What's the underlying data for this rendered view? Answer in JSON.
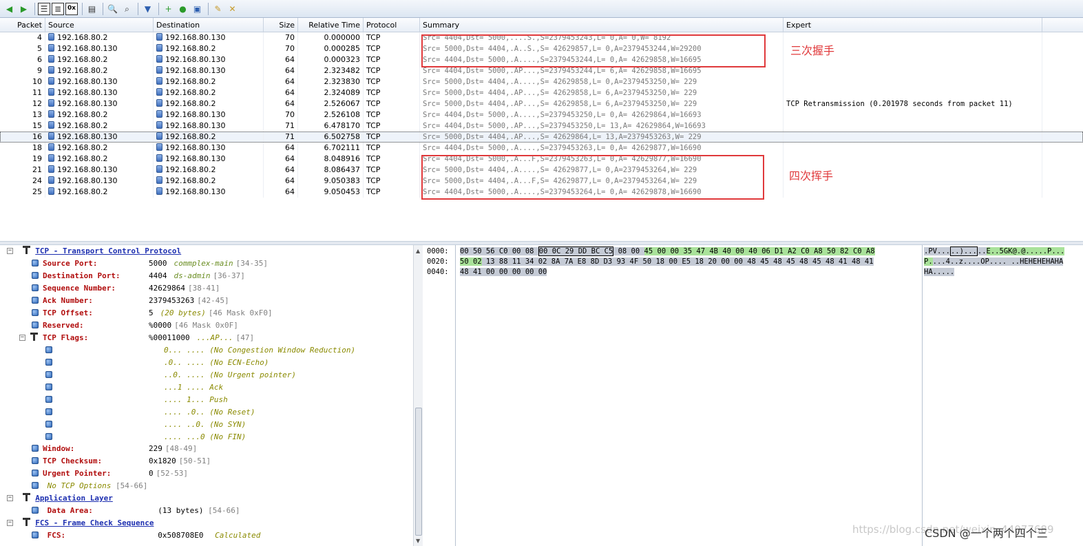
{
  "toolbar": {
    "buttons": [
      "back-icon",
      "forward-icon",
      "list-view-icon",
      "details-view-icon",
      "hex-view-icon",
      "packet-view-icon",
      "search-icon",
      "find-next-icon",
      "filter-icon",
      "add-icon",
      "capture-icon",
      "save-icon",
      "edit-icon",
      "clear-icon"
    ],
    "hex_button_label": "0x"
  },
  "grid": {
    "columns": [
      "Packet",
      "Source",
      "Destination",
      "Size",
      "Relative Time",
      "Protocol",
      "Summary",
      "Expert"
    ],
    "rows": [
      {
        "packet": "4",
        "source": "192.168.80.2",
        "dest": "192.168.80.130",
        "size": "70",
        "time": "0.000000",
        "protocol": "TCP",
        "summary": "Src= 4404,Dst= 5000,....S.,S=2379453243,L=    0,A=         0,W= 8192",
        "expert": ""
      },
      {
        "packet": "5",
        "source": "192.168.80.130",
        "dest": "192.168.80.2",
        "size": "70",
        "time": "0.000285",
        "protocol": "TCP",
        "summary": "Src= 5000,Dst= 4404,.A..S.,S=  42629857,L=    0,A=2379453244,W=29200",
        "expert": ""
      },
      {
        "packet": "6",
        "source": "192.168.80.2",
        "dest": "192.168.80.130",
        "size": "64",
        "time": "0.000323",
        "protocol": "TCP",
        "summary": "Src= 4404,Dst= 5000,.A....,S=2379453244,L=    0,A=  42629858,W=16695",
        "expert": ""
      },
      {
        "packet": "9",
        "source": "192.168.80.2",
        "dest": "192.168.80.130",
        "size": "64",
        "time": "2.323482",
        "protocol": "TCP",
        "summary": "Src= 4404,Dst= 5000,.AP...,S=2379453244,L=    6,A=  42629858,W=16695",
        "expert": ""
      },
      {
        "packet": "10",
        "source": "192.168.80.130",
        "dest": "192.168.80.2",
        "size": "64",
        "time": "2.323830",
        "protocol": "TCP",
        "summary": "Src= 5000,Dst= 4404,.A....,S=  42629858,L=    0,A=2379453250,W=  229",
        "expert": ""
      },
      {
        "packet": "11",
        "source": "192.168.80.130",
        "dest": "192.168.80.2",
        "size": "64",
        "time": "2.324089",
        "protocol": "TCP",
        "summary": "Src= 5000,Dst= 4404,.AP...,S=  42629858,L=    6,A=2379453250,W=  229",
        "expert": ""
      },
      {
        "packet": "12",
        "source": "192.168.80.130",
        "dest": "192.168.80.2",
        "size": "64",
        "time": "2.526067",
        "protocol": "TCP",
        "summary": "Src= 5000,Dst= 4404,.AP...,S=  42629858,L=    6,A=2379453250,W=  229",
        "expert": "TCP Retransmission (0.201978 seconds from packet 11)"
      },
      {
        "packet": "13",
        "source": "192.168.80.2",
        "dest": "192.168.80.130",
        "size": "70",
        "time": "2.526108",
        "protocol": "TCP",
        "summary": "Src= 4404,Dst= 5000,.A....,S=2379453250,L=    0,A=  42629864,W=16693",
        "expert": ""
      },
      {
        "packet": "15",
        "source": "192.168.80.2",
        "dest": "192.168.80.130",
        "size": "71",
        "time": "6.478170",
        "protocol": "TCP",
        "summary": "Src= 4404,Dst= 5000,.AP...,S=2379453250,L=   13,A=  42629864,W=16693",
        "expert": ""
      },
      {
        "packet": "16",
        "source": "192.168.80.130",
        "dest": "192.168.80.2",
        "size": "71",
        "time": "6.502758",
        "protocol": "TCP",
        "summary": "Src= 5000,Dst= 4404,.AP...,S=  42629864,L=   13,A=2379453263,W=  229",
        "expert": ""
      },
      {
        "packet": "18",
        "source": "192.168.80.2",
        "dest": "192.168.80.130",
        "size": "64",
        "time": "6.702111",
        "protocol": "TCP",
        "summary": "Src= 4404,Dst= 5000,.A....,S=2379453263,L=    0,A=  42629877,W=16690",
        "expert": ""
      },
      {
        "packet": "19",
        "source": "192.168.80.2",
        "dest": "192.168.80.130",
        "size": "64",
        "time": "8.048916",
        "protocol": "TCP",
        "summary": "Src= 4404,Dst= 5000,.A...F,S=2379453263,L=    0,A=  42629877,W=16690",
        "expert": ""
      },
      {
        "packet": "21",
        "source": "192.168.80.130",
        "dest": "192.168.80.2",
        "size": "64",
        "time": "8.086437",
        "protocol": "TCP",
        "summary": "Src= 5000,Dst= 4404,.A....,S=  42629877,L=    0,A=2379453264,W=  229",
        "expert": ""
      },
      {
        "packet": "24",
        "source": "192.168.80.130",
        "dest": "192.168.80.2",
        "size": "64",
        "time": "9.050383",
        "protocol": "TCP",
        "summary": "Src= 5000,Dst= 4404,.A...F,S=  42629877,L=    0,A=2379453264,W=  229",
        "expert": ""
      },
      {
        "packet": "25",
        "source": "192.168.80.2",
        "dest": "192.168.80.130",
        "size": "64",
        "time": "9.050453",
        "protocol": "TCP",
        "summary": "Src= 4404,Dst= 5000,.A....,S=2379453264,L=    0,A=  42629878,W=16690",
        "expert": ""
      }
    ],
    "selected_row": 9
  },
  "annotations": {
    "three_way": "三次握手",
    "four_way": "四次挥手"
  },
  "tree": {
    "tcp_title": "TCP - Transport Control Protocol",
    "fields": [
      {
        "name": "Source Port:",
        "value": "5000",
        "extra": "commplex-main",
        "range": "[34-35]"
      },
      {
        "name": "Destination Port:",
        "value": "4404",
        "extra": "ds-admin",
        "range": "[36-37]"
      },
      {
        "name": "Sequence Number:",
        "value": "42629864",
        "extra": "",
        "range": "[38-41]"
      },
      {
        "name": "Ack Number:",
        "value": "2379453263",
        "extra": "",
        "range": "[42-45]"
      },
      {
        "name": "TCP Offset:",
        "value": "5",
        "extra": "(20 bytes)",
        "range": "[46 Mask 0xF0]"
      },
      {
        "name": "Reserved:",
        "value": "%0000",
        "extra": "",
        "range": "[46 Mask 0x0F]"
      },
      {
        "name": "TCP Flags:",
        "value": "%00011000",
        "extra": "...AP...",
        "range": "[47]"
      }
    ],
    "flags": [
      "0... .... (No Congestion Window Reduction)",
      ".0.. .... (No ECN-Echo)",
      "..0. .... (No Urgent pointer)",
      "...1 .... Ack",
      ".... 1... Push",
      ".... .0.. (No Reset)",
      ".... ..0. (No SYN)",
      ".... ...0 (No FIN)"
    ],
    "fields2": [
      {
        "name": "Window:",
        "value": "229",
        "range": "[48-49]"
      },
      {
        "name": "TCP Checksum:",
        "value": "0x1820",
        "range": "[50-51]"
      },
      {
        "name": "Urgent Pointer:",
        "value": "0",
        "range": "[52-53]"
      }
    ],
    "no_options": "No TCP Options",
    "no_options_range": "[54-66]",
    "app_title": "Application Layer",
    "data_area_name": "Data Area:",
    "data_area_value": "(13 bytes)",
    "data_area_range": "[54-66]",
    "fcs_title": "FCS - Frame Check Sequence",
    "fcs_name": "FCS:",
    "fcs_value": "0x508708E0",
    "fcs_extra": "Calculated"
  },
  "hex": {
    "offsets": [
      "0000:",
      "0020:",
      "0040:"
    ],
    "line0": {
      "a": "00 50 56 C0 00 08 ",
      "sel": "00 0C 29 DD BC C5",
      "b": " 08 00 ",
      "g": "45 00 00 35 47 4B 40 00 40 06 D1 A2 C0 A8 50 82 C0 A8"
    },
    "line1": {
      "g": "50 02",
      "b": " 13 88 11 34 02 8A 7A E8 8D D3 93 4F 50 18 00 E5 18 20 00 00 48 45 48 45 48 45 48 41 48 41"
    },
    "line2": {
      "b": "48 41 00 00 00 00 00"
    },
    "ascii0": {
      "a": ".PV...",
      "sel": "..)...",
      "b": "..",
      "g": "E..5GK@.@.....P..."
    },
    "ascii1": {
      "g": "P.",
      "b": "...4..z....OP.... ..HEHEHEHAHA"
    },
    "ascii2": {
      "b": "HA....."
    }
  },
  "watermark": "https://blog.csdn.net/weixin_44077689",
  "csdn_mark": "CSDN @一个两个四个三"
}
